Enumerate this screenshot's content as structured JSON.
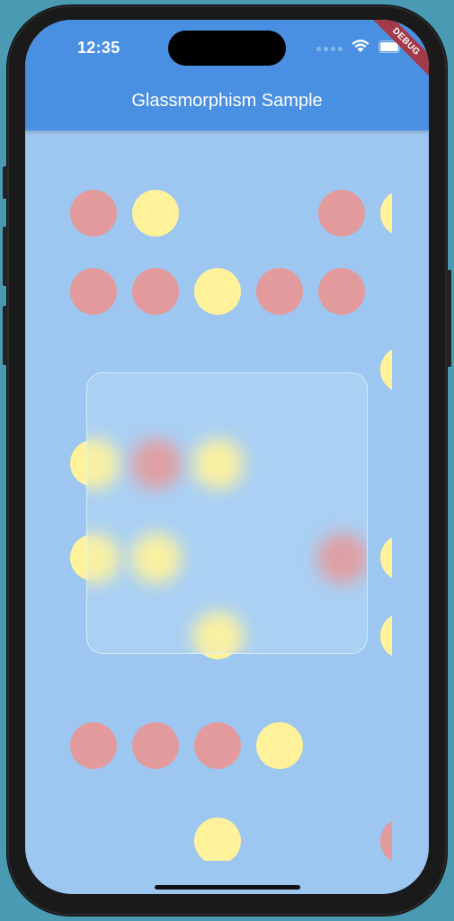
{
  "status_bar": {
    "time": "12:35"
  },
  "app_bar": {
    "title": "Glassmorphism Sample"
  },
  "debug_banner": {
    "label": "DEBUG"
  },
  "colors": {
    "app_bar": "#4a90e2",
    "background": "#9dc7f0",
    "red_circle": "#e39a9c",
    "yellow_circle": "#fff29a",
    "debug_ribbon": "#a33a4a"
  },
  "circle_grid": {
    "rows": [
      [
        "red",
        "yellow",
        "empty",
        "empty",
        "red",
        "yellow"
      ],
      [
        "red",
        "red",
        "yellow",
        "red",
        "red",
        "empty"
      ],
      [
        "empty",
        "empty",
        "empty",
        "empty",
        "empty",
        "yellow"
      ],
      [
        "yellow",
        "red",
        "yellow",
        "empty",
        "empty",
        "empty"
      ],
      [
        "yellow",
        "yellow",
        "empty",
        "empty",
        "red",
        "yellow"
      ],
      [
        "empty",
        "empty",
        "yellow",
        "empty",
        "empty",
        "yellow"
      ],
      [
        "red",
        "red",
        "red",
        "yellow",
        "empty",
        "empty"
      ],
      [
        "empty",
        "empty",
        "yellow",
        "empty",
        "empty",
        "red"
      ]
    ]
  },
  "glass_panel": {
    "label": "glass-card"
  }
}
